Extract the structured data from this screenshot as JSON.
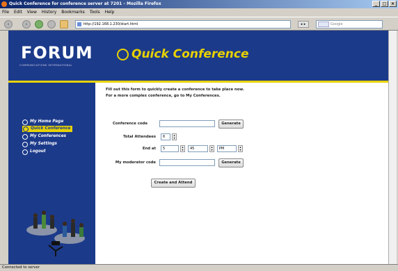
{
  "window": {
    "title": "Quick Conference for conference server at 7201 - Mozilla Firefox",
    "buttons": {
      "minimize": "_",
      "maximize": "□",
      "close": "×"
    }
  },
  "menu": [
    "File",
    "Edit",
    "View",
    "History",
    "Bookmarks",
    "Tools",
    "Help"
  ],
  "toolbar": {
    "url": "http://192.168.1.230/start.html",
    "search_placeholder": "Google"
  },
  "header": {
    "logo": "FORUM",
    "logo_subtitle": "COMMUNICATIONS INTERNATIONAL",
    "page_title": "Quick Conference"
  },
  "sidebar": {
    "items": [
      {
        "label": "My Home Page",
        "active": false
      },
      {
        "label": "Quick Conference",
        "active": true
      },
      {
        "label": "My Conferences",
        "active": false
      },
      {
        "label": "My Settings",
        "active": false
      },
      {
        "label": "Logout",
        "active": false
      }
    ]
  },
  "content": {
    "intro_line1": "Fill out this form to quickly create a conference to take place now.",
    "intro_line2": "For a more complex conference, go to My Conferences.",
    "form": {
      "conference_code_label": "Conference code",
      "conference_code_value": "",
      "generate_label": "Generate",
      "total_attendees_label": "Total Attendees",
      "total_attendees_value": "6",
      "end_at_label": "End at",
      "end_hour": "5",
      "end_minute": "45",
      "end_ampm": "PM",
      "moderator_code_label": "My moderator code",
      "moderator_code_value": "",
      "generate2_label": "Generate",
      "submit_label": "Create and Attend"
    }
  },
  "status": "Connected to server"
}
